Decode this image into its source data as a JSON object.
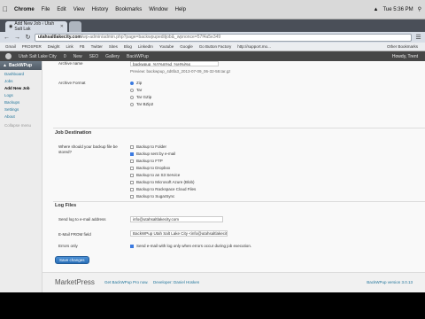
{
  "menubar": {
    "app": "Chrome",
    "items": [
      "File",
      "Edit",
      "View",
      "History",
      "Bookmarks",
      "Window",
      "Help"
    ],
    "clock": "Tue 5:36 PM"
  },
  "tabs": [
    {
      "label": "Add New Job ‹ Utah Salt Lak",
      "active": true
    }
  ],
  "toolbar": {
    "url_host": "utahsaltlakecity.com",
    "url_rest": "/wp-admin/admin.php?page=backwpupeditjob&_wpnonce=57f4a5e349"
  },
  "bookmarks": {
    "items": [
      "Gmail",
      "PROSPER",
      "Dwight",
      "Link",
      "FB",
      "Twitter",
      "Sites",
      "Blog",
      "LinkedIn",
      "Youtube",
      "Google",
      "Go Button Factory",
      "http://support.mo..."
    ],
    "other": "Other Bookmarks"
  },
  "adminbar": {
    "site": "Utah Salt Lake City",
    "items": [
      "0",
      "New",
      "SEO",
      "Gallery",
      "BackWPup"
    ],
    "howdy": "Howdy, Trent"
  },
  "sidebar": {
    "title": "BackWPup",
    "items": [
      "Dashboard",
      "Jobs",
      "Add New Job",
      "Logs",
      "Backups",
      "Settings",
      "About"
    ],
    "current": "Add New Job",
    "collapse": "Collapse menu"
  },
  "main": {
    "archive_name_label": "Archive name",
    "archive_name_value": "backwpup_%Y%m%d_%H%i%s",
    "preview": "Preview: backwpup_4d6fa3_2013-07-09_06-32-58.tar.gz",
    "archive_format_label": "Archive Format",
    "formats": [
      "Zip",
      "Tar",
      "Tar GZip",
      "Tar BZip2"
    ],
    "job_destination_head": "Job Destination",
    "destination_question": "Where should your backup file be stored?",
    "destinations": [
      "Backup to Folder",
      "Backup sent by e-mail",
      "Backup to FTP",
      "Backup to Dropbox",
      "Backup to an S3 Service",
      "Backup to Microsoft Azure (Blob)",
      "Backup to Rackspace Cloud Files",
      "Backup to SugarSync"
    ],
    "log_files_head": "Log Files",
    "send_log_label": "Send log to e-mail address",
    "send_log_value": "info@utahsaltlakecity.com",
    "from_label": "E-Mail FROM field",
    "from_value": "BackWPup Utah Salt Lake City <info@utahsaltlakecity.",
    "errors_label": "Errors only",
    "errors_text": "Send e-mail with log only when errors occur during job execution.",
    "save_button": "Save changes"
  },
  "footer": {
    "logo": "MarketPress",
    "thanks": "Get BackWPup Pro now.",
    "developer": "Developer: Daniel Hüsken",
    "version": "BackWPup version 3.0.13"
  }
}
